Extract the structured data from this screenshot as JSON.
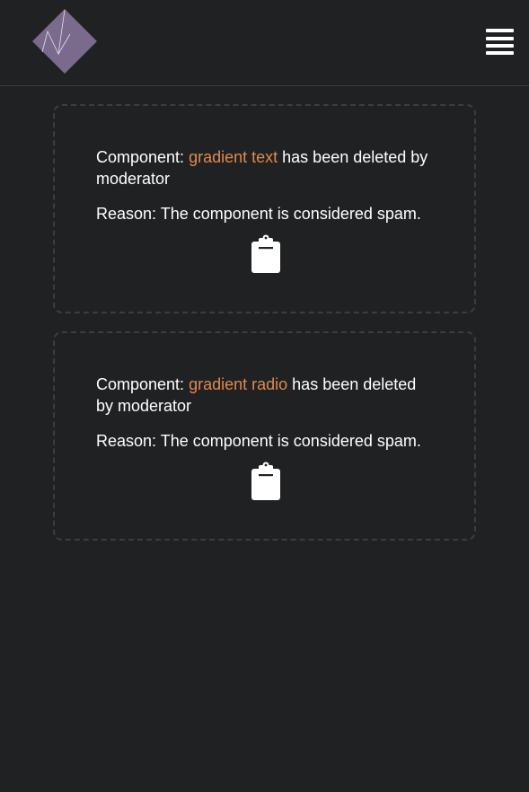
{
  "header": {
    "logo_icon": "diamond-logo",
    "menu_icon": "hamburger-menu-icon"
  },
  "cards": [
    {
      "prefix": "Component:",
      "component_name": "gradient text",
      "suffix": "has been deleted by moderator",
      "reason": "Reason: The component is considered spam.",
      "action_icon": "clipboard-icon"
    },
    {
      "prefix": "Component:",
      "component_name": "gradient radio",
      "suffix": "has been deleted by moderator",
      "reason": "Reason: The component is considered spam.",
      "action_icon": "clipboard-icon"
    }
  ],
  "colors": {
    "background": "#1f2123",
    "accent": "#e2894e",
    "logo": "#7a6a8c",
    "card_border": "#3b3e41"
  }
}
